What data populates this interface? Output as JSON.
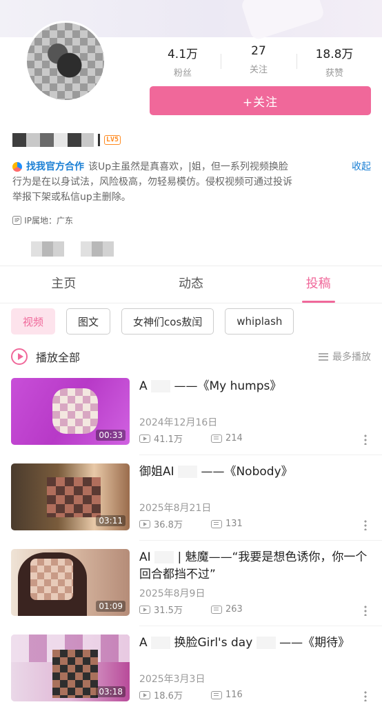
{
  "profile": {
    "stats": [
      {
        "value": "4.1万",
        "label": "粉丝"
      },
      {
        "value": "27",
        "label": "关注"
      },
      {
        "value": "18.8万",
        "label": "获赞"
      }
    ],
    "follow_label": "+关注",
    "level_badge": "LV5",
    "bio_link": "找我官方合作",
    "bio_line1": "该Up主虽然是真喜欢，|姐，但一系列视频换脸",
    "bio_collapse": "收起",
    "bio_line2": "行为是在以身试法，风险极高，勿轻易模仿。侵权视频可通过投诉",
    "bio_line3": "举报下架或私信up主删除。",
    "ip_icon": "IP",
    "ip_location": "IP属地：广东"
  },
  "tabs": [
    {
      "label": "主页",
      "active": false
    },
    {
      "label": "动态",
      "active": false
    },
    {
      "label": "投稿",
      "active": true
    }
  ],
  "chips": [
    {
      "label": "视频",
      "active": true
    },
    {
      "label": "图文",
      "active": false
    },
    {
      "label": "女神们cos敖闰",
      "active": false
    },
    {
      "label": "whiplash",
      "active": false
    }
  ],
  "play_all": {
    "label": "播放全部",
    "sort_label": "最多播放"
  },
  "videos": [
    {
      "title_a": "A",
      "title_b": "——《My humps》",
      "date": "2024年12月16日",
      "views": "41.1万",
      "danmaku": "214",
      "duration": "00:33"
    },
    {
      "title_a": "御姐AI",
      "title_b": "——《Nobody》",
      "date": "2025年8月21日",
      "views": "36.8万",
      "danmaku": "131",
      "duration": "03:11"
    },
    {
      "title_a": "AI",
      "title_b": "| 魅魔——“我要是想色诱你，你一个回合都挡不过”",
      "date": "2025年8月9日",
      "views": "31.5万",
      "danmaku": "263",
      "duration": "01:09"
    },
    {
      "title_a": "A",
      "title_b": "换脸Girl's day",
      "title_c": "——《期待》",
      "date": "2025年3月3日",
      "views": "18.6万",
      "danmaku": "116",
      "duration": "03:18"
    }
  ],
  "colors": {
    "accent": "#f0689a",
    "link": "#1a7fd4",
    "level": "#ff8a1f"
  }
}
